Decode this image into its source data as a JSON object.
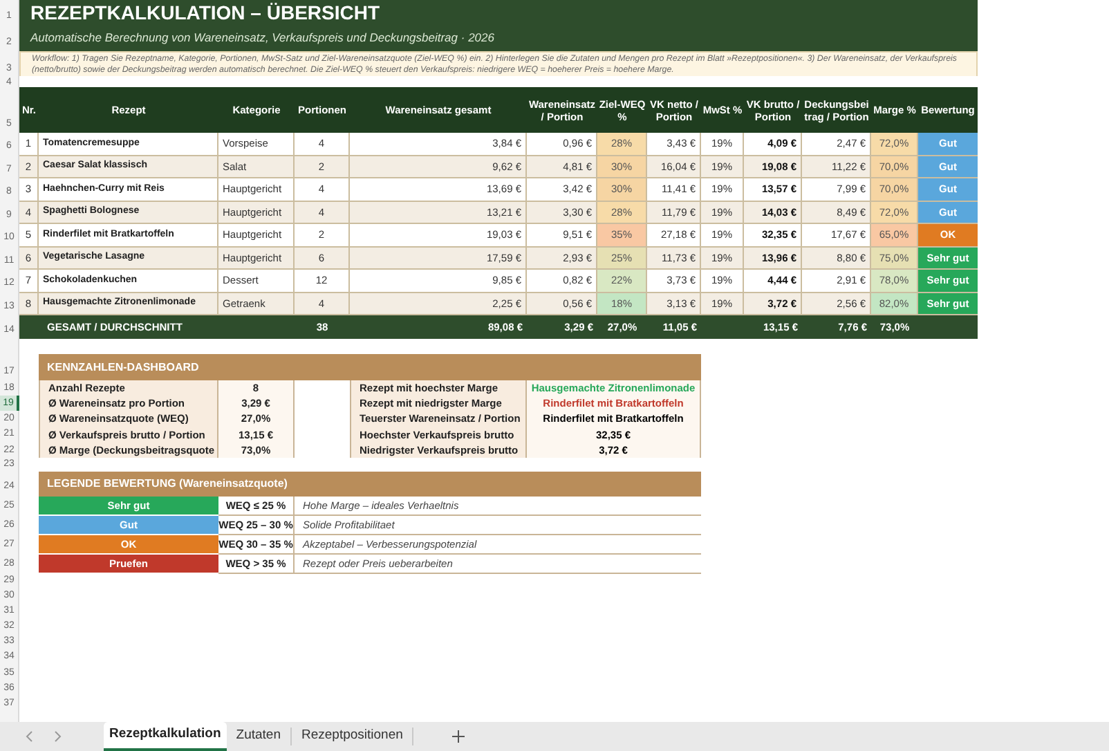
{
  "title": "REZEPTKALKULATION – ÜBERSICHT",
  "subtitle": "Automatische Berechnung von Wareneinsatz, Verkaufspreis und Deckungsbeitrag · 2026",
  "workflow_note": "Workflow: 1) Tragen Sie Rezeptname, Kategorie, Portionen, MwSt-Satz und Ziel-Wareneinsatzquote (Ziel-WEQ %) ein. 2) Hinterlegen Sie die Zutaten und Mengen pro Rezept im Blatt »Rezeptpositionen«. 3) Der Wareneinsatz, der Verkaufspreis (netto/brutto) sowie der Deckungsbeitrag werden automatisch berechnet. Die Ziel-WEQ % steuert den Verkaufspreis: niedrigere WEQ = hoeherer Preis = hoehere Marge.",
  "row_numbers": [
    {
      "label": "1",
      "selected": false
    },
    {
      "label": "2",
      "selected": false
    },
    {
      "label": "3",
      "selected": false
    },
    {
      "label": "4",
      "selected": false
    },
    {
      "label": "5",
      "selected": false
    },
    {
      "label": "6",
      "selected": false
    },
    {
      "label": "7",
      "selected": false
    },
    {
      "label": "8",
      "selected": false
    },
    {
      "label": "9",
      "selected": false
    },
    {
      "label": "10",
      "selected": false
    },
    {
      "label": "11",
      "selected": false
    },
    {
      "label": "12",
      "selected": false
    },
    {
      "label": "13",
      "selected": false
    },
    {
      "label": "14",
      "selected": false
    },
    {
      "label": "17",
      "selected": false
    },
    {
      "label": "18",
      "selected": false
    },
    {
      "label": "19",
      "selected": true
    },
    {
      "label": "20",
      "selected": false
    },
    {
      "label": "21",
      "selected": false
    },
    {
      "label": "22",
      "selected": false
    },
    {
      "label": "23",
      "selected": false
    },
    {
      "label": "24",
      "selected": false
    },
    {
      "label": "25",
      "selected": false
    },
    {
      "label": "26",
      "selected": false
    },
    {
      "label": "27",
      "selected": false
    },
    {
      "label": "28",
      "selected": false
    },
    {
      "label": "29",
      "selected": false
    },
    {
      "label": "30",
      "selected": false
    },
    {
      "label": "31",
      "selected": false
    },
    {
      "label": "32",
      "selected": false
    },
    {
      "label": "33",
      "selected": false
    },
    {
      "label": "34",
      "selected": false
    },
    {
      "label": "35",
      "selected": false
    },
    {
      "label": "36",
      "selected": false
    },
    {
      "label": "37",
      "selected": false
    }
  ],
  "table": {
    "columns": [
      "Nr.",
      "Rezept",
      "Kategorie",
      "Portionen",
      "Wareneinsatz gesamt",
      "Wareneinsatz / Portion",
      "Ziel-WEQ %",
      "VK netto / Portion",
      "MwSt %",
      "VK brutto / Portion",
      "Deckungsbeitrag / Portion",
      "Marge %",
      "Bewertung"
    ],
    "rows": [
      {
        "nr": "1",
        "rezept": "Tomatencremesuppe",
        "kategorie": "Vorspeise",
        "portionen": "4",
        "we_gesamt": "3,84 €",
        "we_portion": "0,96 €",
        "ziel_weq": {
          "text": "28%",
          "color": "#f7dba8"
        },
        "vk_netto": "3,43 €",
        "mwst": "19%",
        "vk_brutto": "4,09 €",
        "deckungsbeitrag": "2,47 €",
        "marge": {
          "text": "72,0%",
          "color": "#f7dba8"
        },
        "bewertung": {
          "label": "Gut",
          "color": "#5aa7dc"
        }
      },
      {
        "nr": "2",
        "rezept": "Caesar Salat klassisch",
        "kategorie": "Salat",
        "portionen": "2",
        "we_gesamt": "9,62 €",
        "we_portion": "4,81 €",
        "ziel_weq": {
          "text": "30%",
          "color": "#f6d5a3"
        },
        "vk_netto": "16,04 €",
        "mwst": "19%",
        "vk_brutto": "19,08 €",
        "deckungsbeitrag": "11,22 €",
        "marge": {
          "text": "70,0%",
          "color": "#f6d5a3"
        },
        "bewertung": {
          "label": "Gut",
          "color": "#5aa7dc"
        }
      },
      {
        "nr": "3",
        "rezept": "Haehnchen-Curry mit Reis",
        "kategorie": "Hauptgericht",
        "portionen": "4",
        "we_gesamt": "13,69 €",
        "we_portion": "3,42 €",
        "ziel_weq": {
          "text": "30%",
          "color": "#f6d5a3"
        },
        "vk_netto": "11,41 €",
        "mwst": "19%",
        "vk_brutto": "13,57 €",
        "deckungsbeitrag": "7,99 €",
        "marge": {
          "text": "70,0%",
          "color": "#f6d5a3"
        },
        "bewertung": {
          "label": "Gut",
          "color": "#5aa7dc"
        }
      },
      {
        "nr": "4",
        "rezept": "Spaghetti Bolognese",
        "kategorie": "Hauptgericht",
        "portionen": "4",
        "we_gesamt": "13,21 €",
        "we_portion": "3,30 €",
        "ziel_weq": {
          "text": "28%",
          "color": "#f7dba8"
        },
        "vk_netto": "11,79 €",
        "mwst": "19%",
        "vk_brutto": "14,03 €",
        "deckungsbeitrag": "8,49 €",
        "marge": {
          "text": "72,0%",
          "color": "#f7dba8"
        },
        "bewertung": {
          "label": "Gut",
          "color": "#5aa7dc"
        }
      },
      {
        "nr": "5",
        "rezept": "Rinderfilet mit Bratkartoffeln",
        "kategorie": "Hauptgericht",
        "portionen": "2",
        "we_gesamt": "19,03 €",
        "we_portion": "9,51 €",
        "ziel_weq": {
          "text": "35%",
          "color": "#f9c8a3"
        },
        "vk_netto": "27,18 €",
        "mwst": "19%",
        "vk_brutto": "32,35 €",
        "deckungsbeitrag": "17,67 €",
        "marge": {
          "text": "65,0%",
          "color": "#f9c8a3"
        },
        "bewertung": {
          "label": "OK",
          "color": "#e07b22"
        }
      },
      {
        "nr": "6",
        "rezept": "Vegetarische Lasagne",
        "kategorie": "Hauptgericht",
        "portionen": "6",
        "we_gesamt": "17,59 €",
        "we_portion": "2,93 €",
        "ziel_weq": {
          "text": "25%",
          "color": "#e6e0b3"
        },
        "vk_netto": "11,73 €",
        "mwst": "19%",
        "vk_brutto": "13,96 €",
        "deckungsbeitrag": "8,80 €",
        "marge": {
          "text": "75,0%",
          "color": "#e6e0b3"
        },
        "bewertung": {
          "label": "Sehr gut",
          "color": "#27a85a"
        }
      },
      {
        "nr": "7",
        "rezept": "Schokoladenkuchen",
        "kategorie": "Dessert",
        "portionen": "12",
        "we_gesamt": "9,85 €",
        "we_portion": "0,82 €",
        "ziel_weq": {
          "text": "22%",
          "color": "#d9e8c3"
        },
        "vk_netto": "3,73 €",
        "mwst": "19%",
        "vk_brutto": "4,44 €",
        "deckungsbeitrag": "2,91 €",
        "marge": {
          "text": "78,0%",
          "color": "#d9e8c3"
        },
        "bewertung": {
          "label": "Sehr gut",
          "color": "#27a85a"
        }
      },
      {
        "nr": "8",
        "rezept": "Hausgemachte Zitronenlimonade",
        "kategorie": "Getraenk",
        "portionen": "4",
        "we_gesamt": "2,25 €",
        "we_portion": "0,56 €",
        "ziel_weq": {
          "text": "18%",
          "color": "#c3e6c3"
        },
        "vk_netto": "3,13 €",
        "mwst": "19%",
        "vk_brutto": "3,72 €",
        "deckungsbeitrag": "2,56 €",
        "marge": {
          "text": "82,0%",
          "color": "#c3e6c3"
        },
        "bewertung": {
          "label": "Sehr gut",
          "color": "#27a85a"
        }
      }
    ],
    "total": {
      "label": "GESAMT / DURCHSCHNITT",
      "portionen": "38",
      "we_gesamt": "89,08 €",
      "we_portion": "3,29 €",
      "ziel_weq": "27,0%",
      "vk_netto": "11,05 €",
      "vk_brutto": "13,15 €",
      "deckungsbeitrag": "7,76 €",
      "marge": "73,0%"
    }
  },
  "dashboard": {
    "title": "KENNZAHLEN-DASHBOARD",
    "left": [
      {
        "label": "Anzahl Rezepte",
        "value": "8"
      },
      {
        "label": "Ø Wareneinsatz pro Portion",
        "value": "3,29 €"
      },
      {
        "label": "Ø Wareneinsatzquote (WEQ)",
        "value": "27,0%"
      },
      {
        "label": "Ø Verkaufspreis brutto / Portion",
        "value": "13,15 €"
      },
      {
        "label": "Ø Marge (Deckungsbeitragsquote",
        "value": "73,0%"
      }
    ],
    "right": [
      {
        "label": "Rezept mit hoechster Marge",
        "value": "Hausgemachte Zitronenlimonade",
        "color": "#27a85a"
      },
      {
        "label": "Rezept mit niedrigster Marge",
        "value": "Rinderfilet mit Bratkartoffeln",
        "color": "#c0392b"
      },
      {
        "label": "Teuerster Wareneinsatz / Portion",
        "value": "Rinderfilet mit Bratkartoffeln"
      },
      {
        "label": "Hoechster Verkaufspreis brutto",
        "value": "32,35 €"
      },
      {
        "label": "Niedrigster Verkaufspreis brutto",
        "value": "3,72 €"
      }
    ]
  },
  "legend": {
    "title": "LEGENDE BEWERTUNG (Wareneinsatzquote)",
    "items": [
      {
        "label": "Sehr gut",
        "color": "#27a85a",
        "range": "WEQ ≤ 25 %",
        "description": "Hohe Marge – ideales Verhaeltnis"
      },
      {
        "label": "Gut",
        "color": "#5aa7dc",
        "range": "WEQ 25 – 30 %",
        "description": "Solide Profitabilitaet"
      },
      {
        "label": "OK",
        "color": "#e07b22",
        "range": "WEQ 30 – 35 %",
        "description": "Akzeptabel – Verbesserungspotenzial"
      },
      {
        "label": "Pruefen",
        "color": "#c0392b",
        "range": "WEQ > 35 %",
        "description": "Rezept oder Preis ueberarbeiten"
      }
    ]
  },
  "sheet_tabs": [
    {
      "label": "Rezeptkalkulation",
      "selected": true
    },
    {
      "label": "Zutaten",
      "selected": false
    },
    {
      "label": "Rezeptpositionen",
      "selected": false
    }
  ]
}
